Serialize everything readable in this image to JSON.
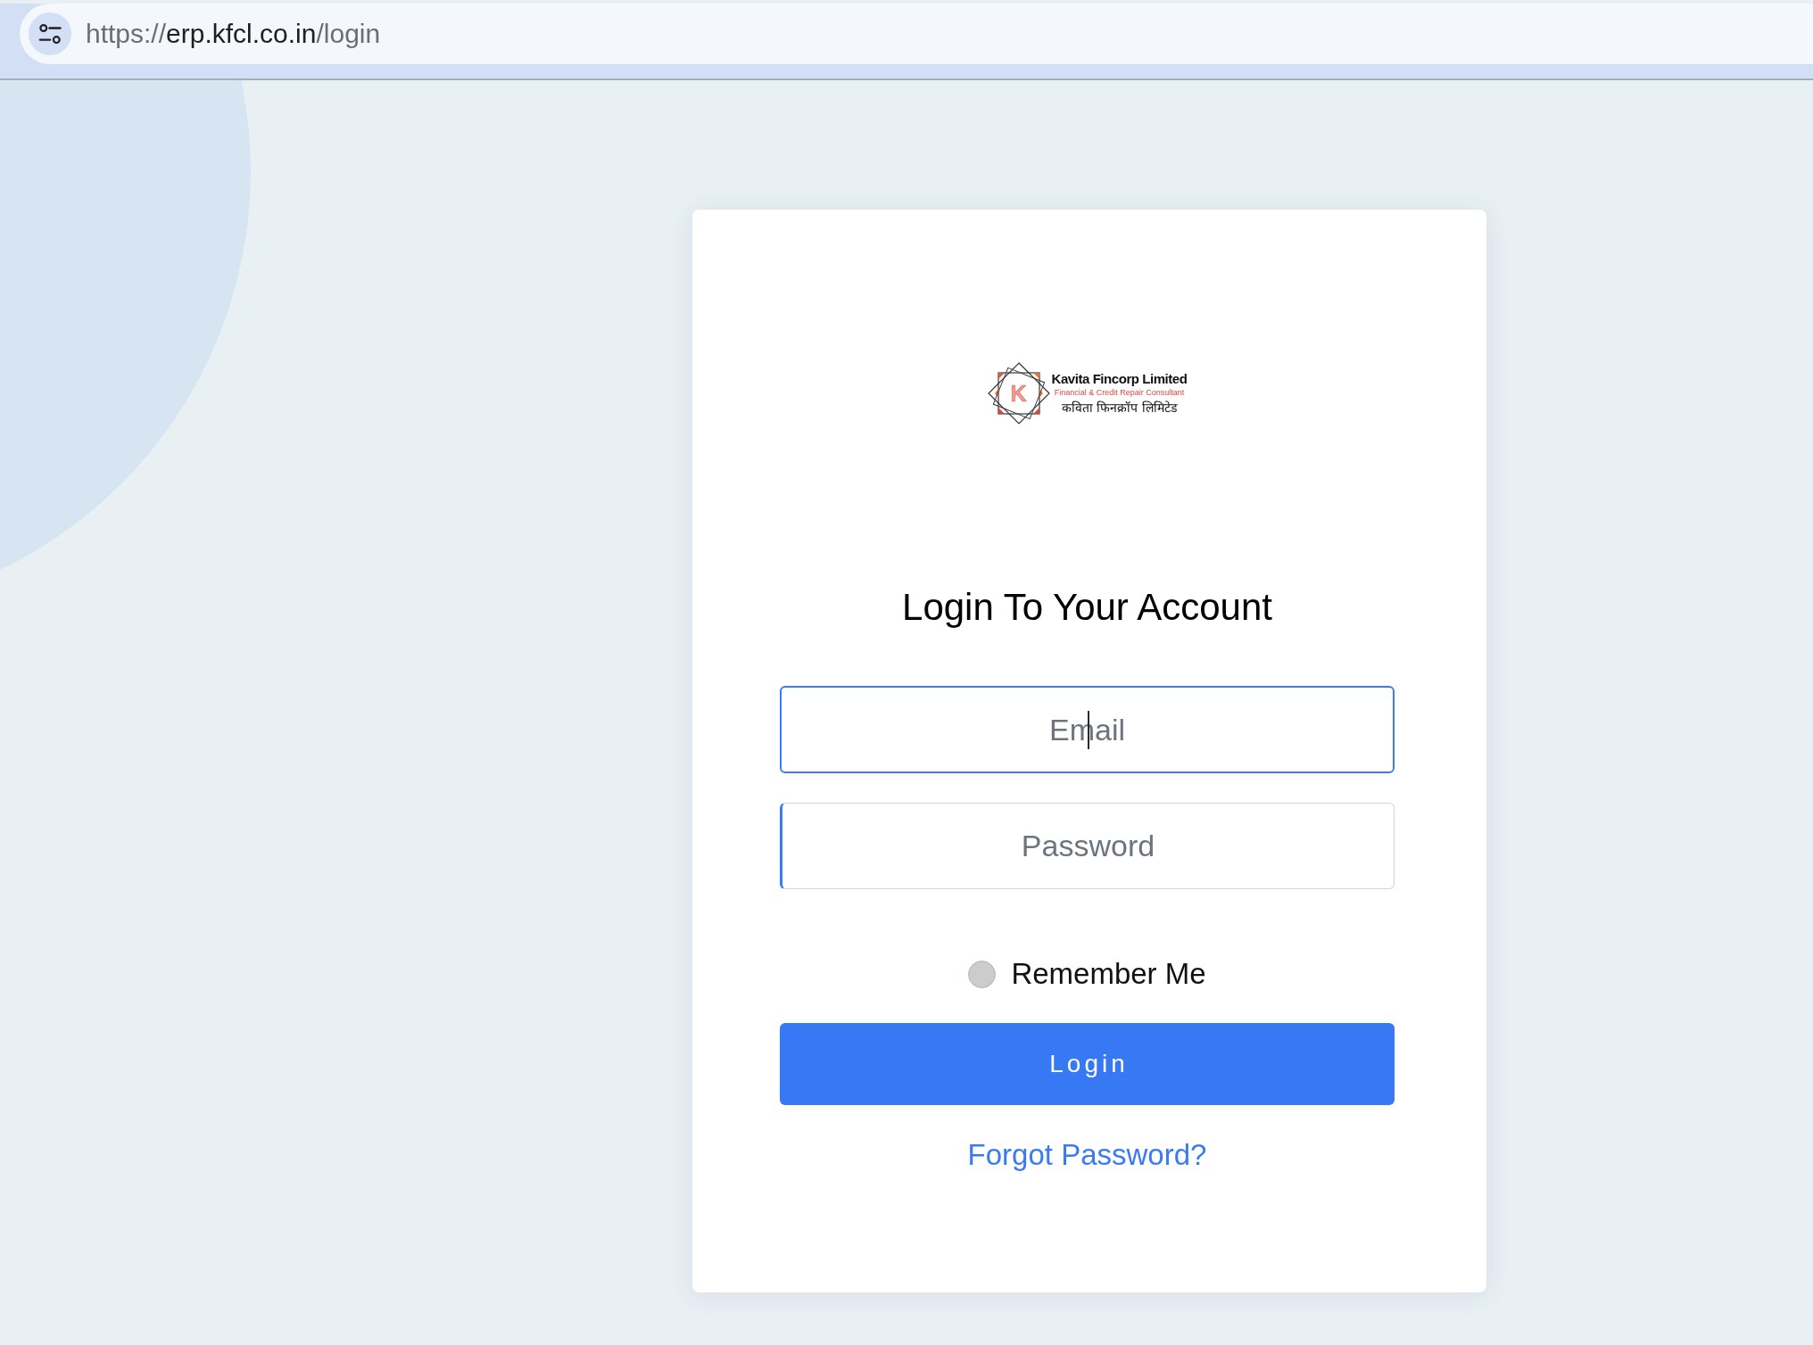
{
  "browser": {
    "url": {
      "scheme": "https://",
      "host": "erp.kfcl.co.in",
      "path": "/login"
    }
  },
  "logo": {
    "monogram": "K",
    "name": "Kavita Fincorp Limited",
    "tagline": "Financial & Credit Repair Consultant",
    "name_hindi": "कविता फिनक्रॉप लिमिटेड"
  },
  "login_card": {
    "title": "Login To Your Account",
    "fields": [
      {
        "placeholder": "Email",
        "focused": true
      },
      {
        "placeholder": "Password",
        "focused": false
      }
    ],
    "remember_me": {
      "label": "Remember Me",
      "checked": false
    },
    "submit_button": "Login",
    "forgot_password_link": "Forgot Password?"
  }
}
